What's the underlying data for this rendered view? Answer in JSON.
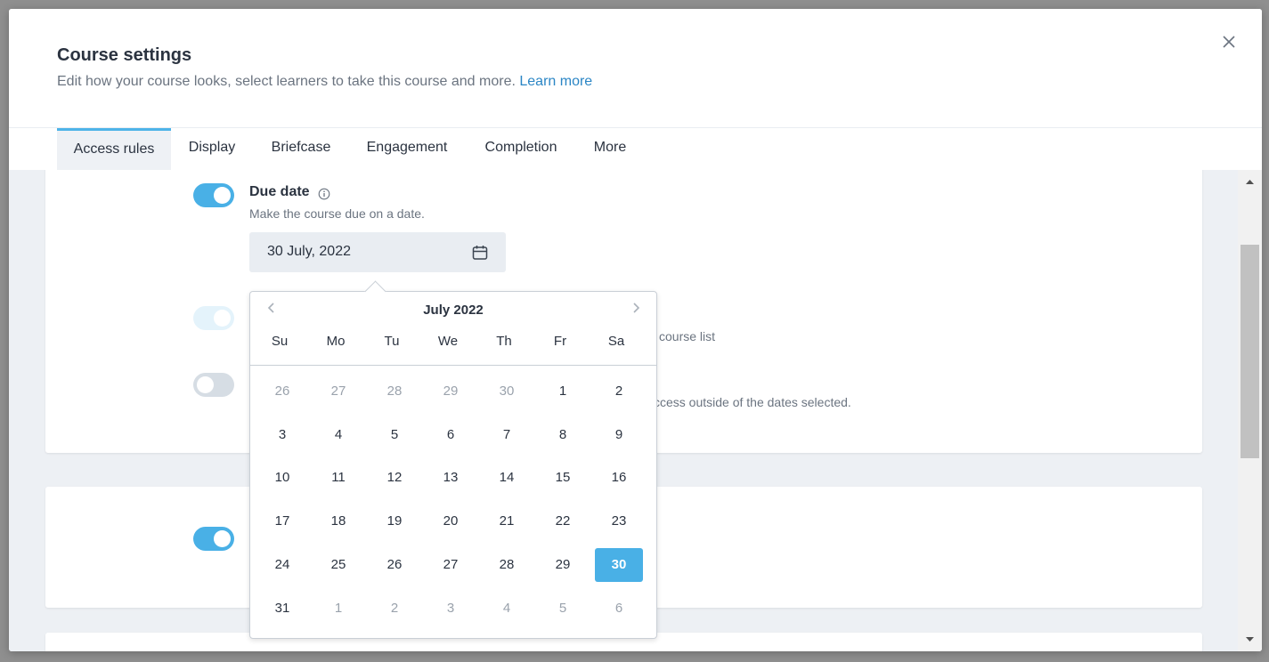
{
  "header": {
    "title": "Course settings",
    "subtitle": "Edit how your course looks, select learners to take this course and more.",
    "learn_more": "Learn more"
  },
  "tabs": [
    {
      "label": "Access rules",
      "active": true
    },
    {
      "label": "Display"
    },
    {
      "label": "Briefcase"
    },
    {
      "label": "Engagement"
    },
    {
      "label": "Completion"
    },
    {
      "label": "More"
    }
  ],
  "due_date": {
    "label": "Due date",
    "description": "Make the course due on a date.",
    "value": "30 July, 2022",
    "enabled": true
  },
  "partial_texts": {
    "course_list": "course list",
    "access_outside": "ccess outside of the dates selected."
  },
  "datepicker": {
    "month_label": "July 2022",
    "weekdays": [
      "Su",
      "Mo",
      "Tu",
      "We",
      "Th",
      "Fr",
      "Sa"
    ],
    "weeks": [
      [
        "26",
        "27",
        "28",
        "29",
        "30",
        "1",
        "2"
      ],
      [
        "3",
        "4",
        "5",
        "6",
        "7",
        "8",
        "9"
      ],
      [
        "10",
        "11",
        "12",
        "13",
        "14",
        "15",
        "16"
      ],
      [
        "17",
        "18",
        "19",
        "20",
        "21",
        "22",
        "23"
      ],
      [
        "24",
        "25",
        "26",
        "27",
        "28",
        "29",
        "30"
      ],
      [
        "31",
        "1",
        "2",
        "3",
        "4",
        "5",
        "6"
      ]
    ],
    "selected": "30"
  },
  "colors": {
    "accent": "#49b0e6",
    "link": "#2b86c5",
    "toggle_off": "#d6dde4"
  }
}
